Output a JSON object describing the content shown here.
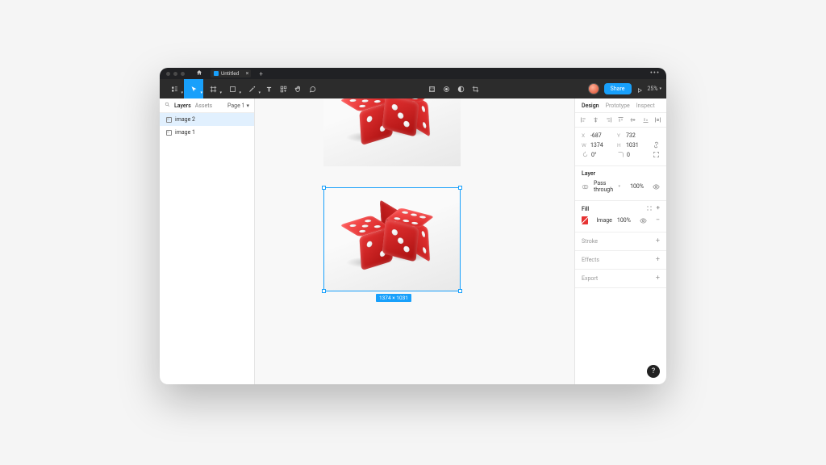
{
  "titlebar": {
    "tab_name": "Untitled"
  },
  "toolbar": {
    "share_label": "Share",
    "zoom": "25%"
  },
  "left_panel": {
    "tabs": {
      "layers": "Layers",
      "assets": "Assets"
    },
    "page_label": "Page 1",
    "layers": [
      {
        "name": "image 2",
        "selected": true
      },
      {
        "name": "image 1",
        "selected": false
      }
    ]
  },
  "canvas": {
    "selection_dims": "1374 × 1031"
  },
  "inspector": {
    "tabs": {
      "design": "Design",
      "prototype": "Prototype",
      "inspect": "Inspect"
    },
    "transform": {
      "x_label": "X",
      "x": "-687",
      "y_label": "Y",
      "y": "732",
      "w_label": "W",
      "w": "1374",
      "h_label": "H",
      "h": "1031",
      "rot": "0°",
      "corner": "0"
    },
    "layer": {
      "title": "Layer",
      "blend": "Pass through",
      "opacity": "100%"
    },
    "fill": {
      "title": "Fill",
      "type": "Image",
      "opacity": "100%"
    },
    "stroke": "Stroke",
    "effects": "Effects",
    "export": "Export"
  }
}
